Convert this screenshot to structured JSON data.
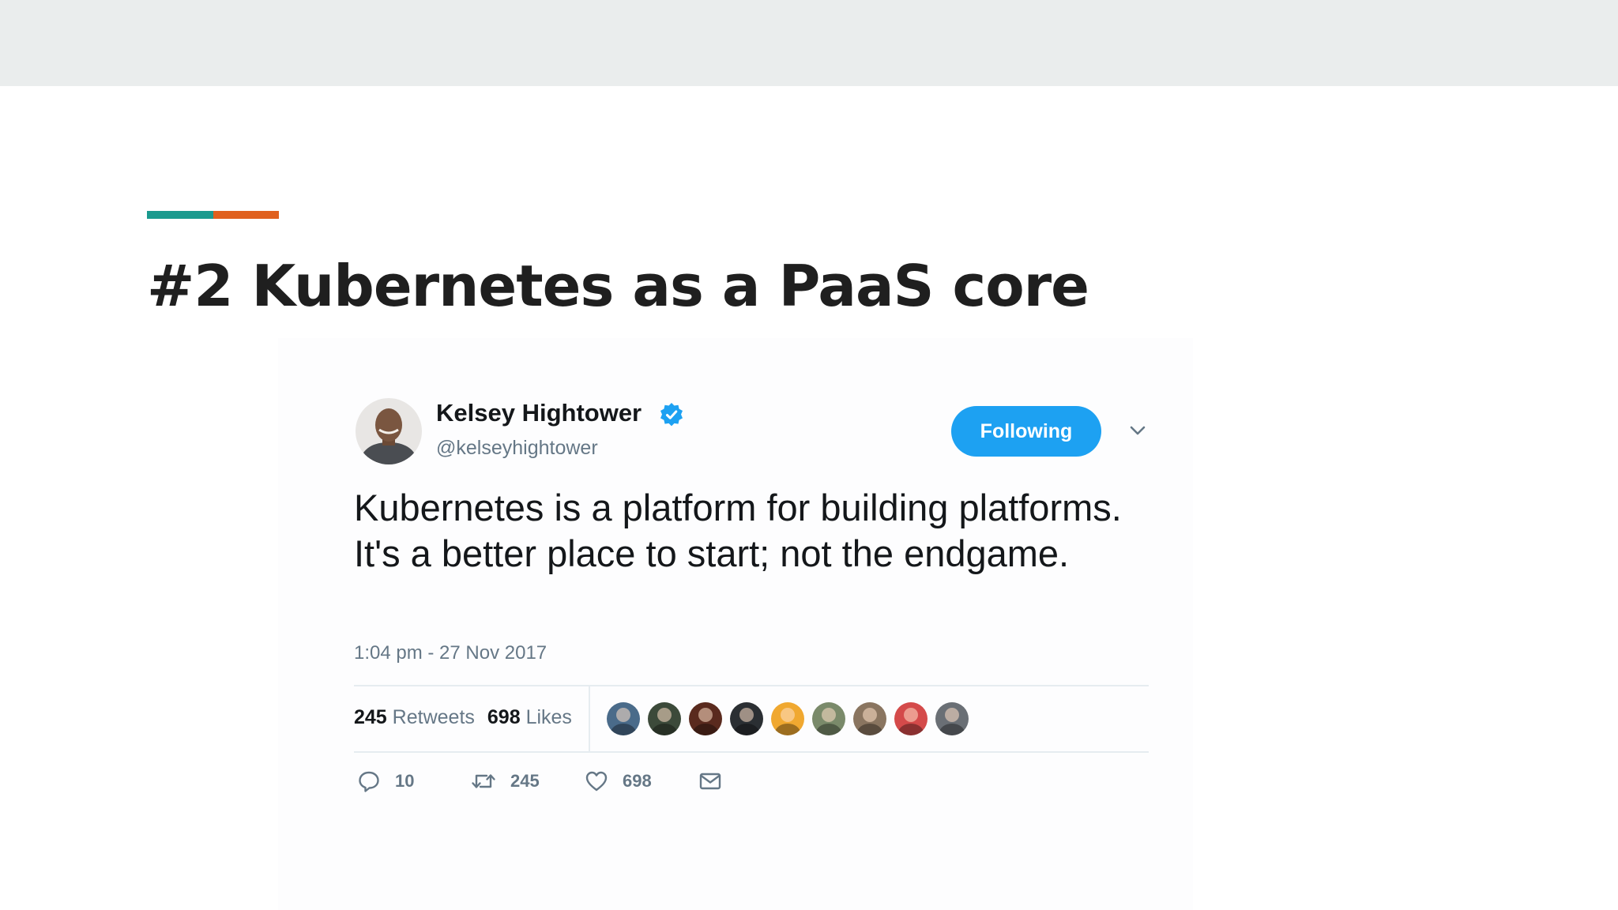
{
  "slide": {
    "title": "#2 Kubernetes as a PaaS core",
    "accent_colors": [
      "#1a9a8e",
      "#e0601d"
    ]
  },
  "tweet": {
    "author_name": "Kelsey Hightower",
    "author_handle": "@kelseyhightower",
    "verified": true,
    "follow_label": "Following",
    "text": "Kubernetes is a platform for building platforms. It's a better place to start; not the endgame.",
    "timestamp": "1:04 pm - 27 Nov 2017",
    "retweets_count": "245",
    "retweets_label": "Retweets",
    "likes_count": "698",
    "likes_label": "Likes",
    "liker_avatar_colors": [
      "#4a6b8a",
      "#3c4a3a",
      "#5a2a1e",
      "#2b2f33",
      "#f0a830",
      "#7a8a6a",
      "#8a7560",
      "#d44a4a",
      "#6a6f75"
    ],
    "actions": {
      "reply_count": "10",
      "retweet_count": "245",
      "like_count": "698"
    },
    "brand_color": "#1da1f2",
    "icons": [
      "verified-badge-icon",
      "chevron-down-icon",
      "reply-icon",
      "retweet-icon",
      "heart-icon",
      "envelope-icon"
    ]
  }
}
